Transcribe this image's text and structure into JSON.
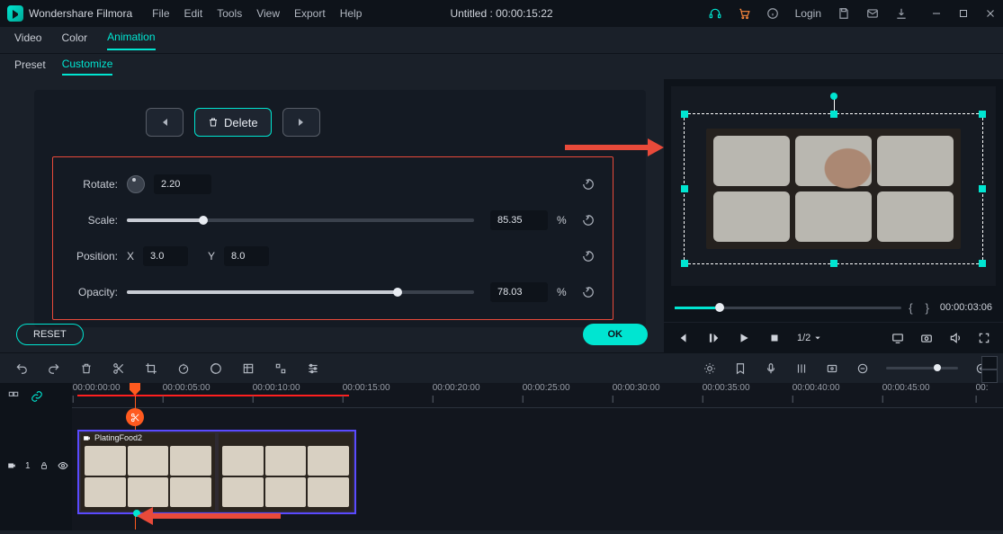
{
  "brand": "Wondershare Filmora",
  "menu": [
    "File",
    "Edit",
    "Tools",
    "View",
    "Export",
    "Help"
  ],
  "title_center": "Untitled : 00:00:15:22",
  "title_right": {
    "login": "Login"
  },
  "tabs": {
    "video": "Video",
    "color": "Color",
    "animation": "Animation"
  },
  "subtabs": {
    "preset": "Preset",
    "customize": "Customize"
  },
  "anim": {
    "delete_label": "Delete",
    "rotate_label": "Rotate:",
    "rotate_val": "2.20",
    "scale_label": "Scale:",
    "scale_val": "85.35",
    "position_label": "Position:",
    "pos_x_label": "X",
    "pos_x": "3.0",
    "pos_y_label": "Y",
    "pos_y": "8.0",
    "opacity_label": "Opacity:",
    "opacity_val": "78.03",
    "percent": "%"
  },
  "actions": {
    "reset": "RESET",
    "ok": "OK"
  },
  "preview": {
    "timecode": "00:00:03:06",
    "speed": "1/2"
  },
  "ruler": {
    "labels": [
      "00:00:00:00",
      "00:00:05:00",
      "00:00:10:00",
      "00:00:15:00",
      "00:00:20:00",
      "00:00:25:00",
      "00:00:30:00",
      "00:00:35:00",
      "00:00:40:00",
      "00:00:45:00",
      "00:"
    ]
  },
  "track": {
    "num": "1"
  },
  "clip": {
    "name": "PlatingFood2"
  }
}
